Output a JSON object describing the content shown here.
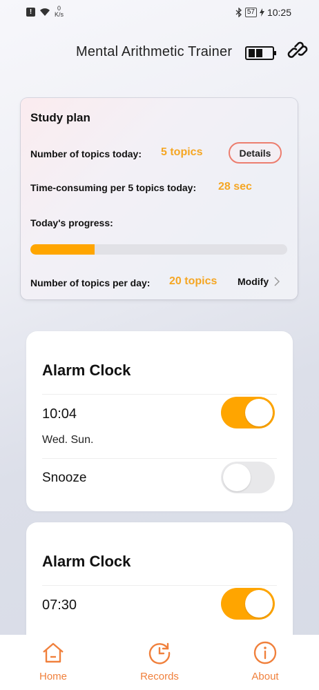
{
  "status_bar": {
    "net_speed_value": "0",
    "net_speed_unit": "K/s",
    "battery_level": "57",
    "time": "10:25"
  },
  "header": {
    "title": "Mental Arithmetic Trainer"
  },
  "study_plan": {
    "title": "Study plan",
    "topics_today_label": "Number of topics today:",
    "topics_today_value": "5 topics",
    "details_label": "Details",
    "time_label": "Time-consuming per 5 topics today:",
    "time_value": "28 sec",
    "progress_label": "Today's progress:",
    "progress_fraction": 0.25,
    "per_day_label": "Number of topics per day:",
    "per_day_value": "20 topics",
    "modify_label": "Modify"
  },
  "alarms": [
    {
      "title": "Alarm Clock",
      "time": "10:04",
      "days": "Wed. Sun.",
      "enabled": true,
      "snooze_label": "Snooze",
      "snooze_enabled": false
    },
    {
      "title": "Alarm Clock",
      "time": "07:30",
      "enabled": true
    }
  ],
  "nav": {
    "home": "Home",
    "records": "Records",
    "about": "About"
  },
  "colors": {
    "accent": "#ffa500",
    "accent_text": "#f5a623",
    "nav": "#f0803c"
  }
}
